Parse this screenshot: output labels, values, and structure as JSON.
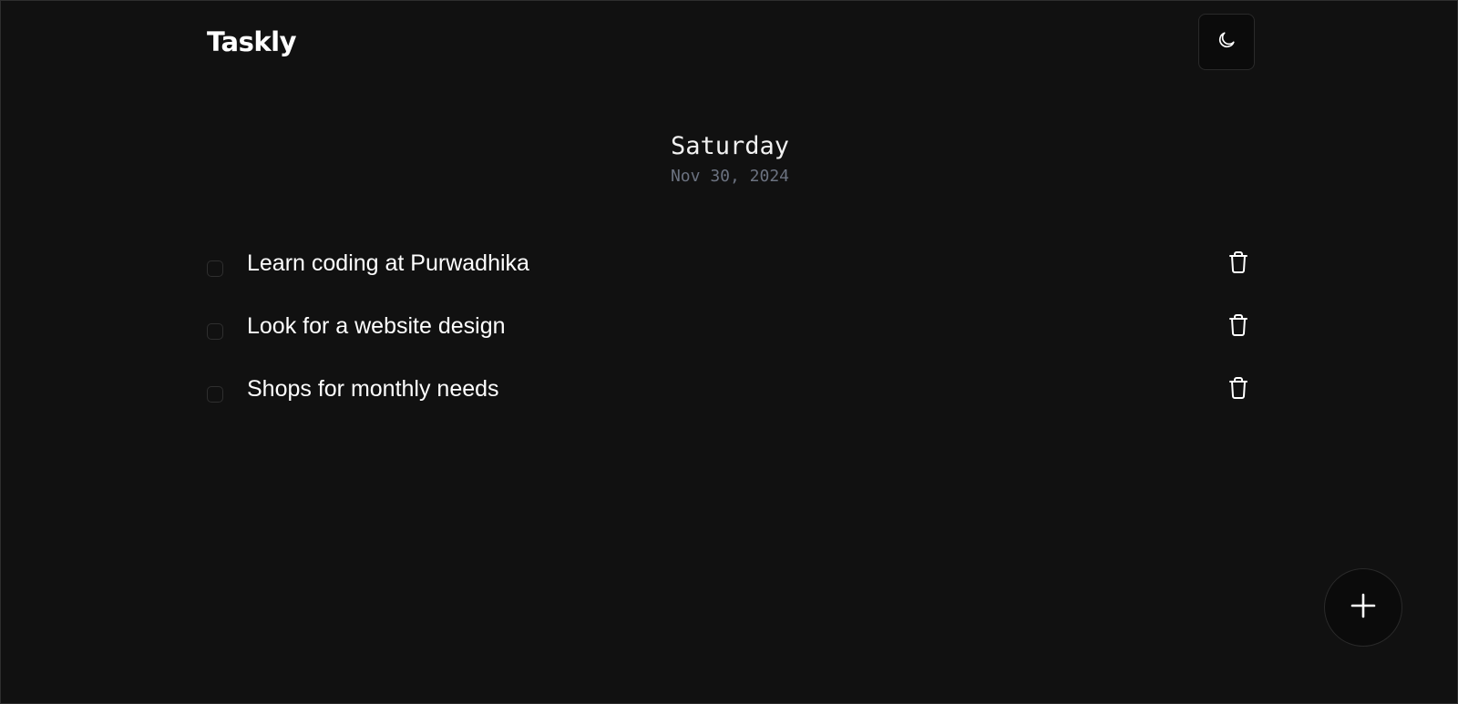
{
  "app": {
    "title": "Taskly"
  },
  "header": {
    "theme_toggle_icon": "moon-icon"
  },
  "date": {
    "day": "Saturday",
    "full": "Nov 30, 2024"
  },
  "tasks": [
    {
      "text": "Learn coding at Purwadhika",
      "completed": false,
      "delete_icon": "trash-icon"
    },
    {
      "text": "Look for a website design",
      "completed": false,
      "delete_icon": "trash-icon"
    },
    {
      "text": "Shops for monthly needs",
      "completed": false,
      "delete_icon": "trash-icon"
    }
  ],
  "fab": {
    "icon": "plus-icon"
  },
  "colors": {
    "background": "#111111",
    "text": "#ffffff",
    "muted": "#6b7280",
    "button_bg": "#0b0b0b"
  }
}
